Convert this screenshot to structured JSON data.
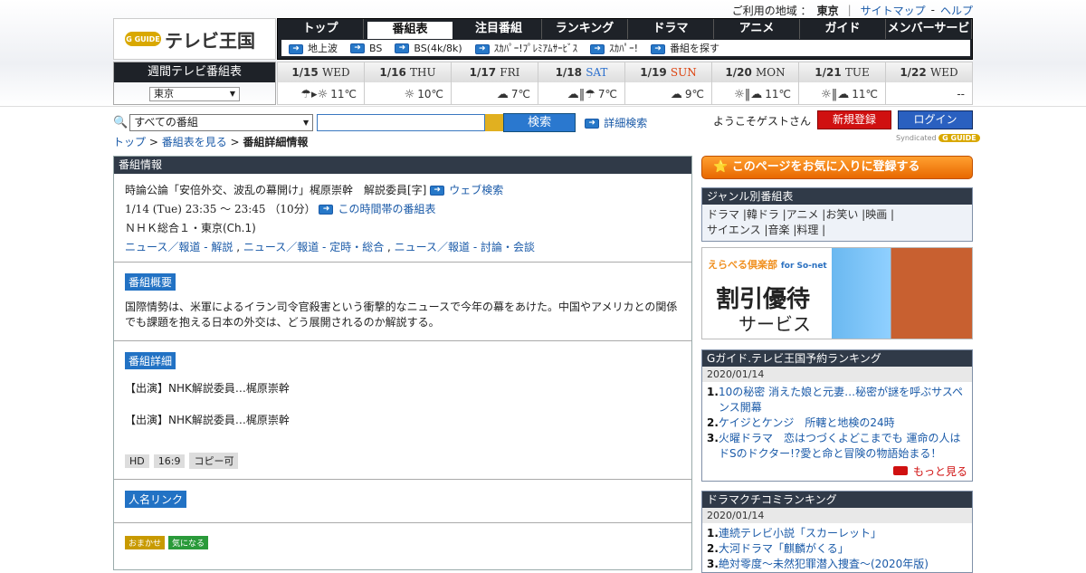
{
  "header": {
    "region_label": "ご利用の地域 ：",
    "region_value": "東京",
    "sitemap": "サイトマップ",
    "help": "ヘルプ",
    "logo_mark": "G GUIDE",
    "logo_text": "テレビ王国",
    "nav": [
      "トップ",
      "番組表",
      "注目番組",
      "ランキング",
      "ドラマ",
      "アニメ",
      "ガイド",
      "メンバーサービス"
    ],
    "subnav": [
      "地上波",
      "BS",
      "BS(4k/8k)",
      "ｽｶﾊﾟｰ!ﾌﾟﾚﾐｱﾑｻｰﾋﾞｽ",
      "ｽｶﾊﾟｰ!",
      "番組を探す"
    ]
  },
  "weekly": {
    "title": "週間テレビ番組表",
    "area": "東京"
  },
  "days": [
    {
      "date": "1/15",
      "wk": "WED",
      "type": "normal",
      "weather": "☂▸☼",
      "temp": "11℃"
    },
    {
      "date": "1/16",
      "wk": "THU",
      "type": "normal",
      "weather": "☼",
      "temp": "10℃"
    },
    {
      "date": "1/17",
      "wk": "FRI",
      "type": "normal",
      "weather": "☁",
      "temp": "7℃"
    },
    {
      "date": "1/18",
      "wk": "SAT",
      "type": "sat",
      "weather": "☁‖☂",
      "temp": "7℃"
    },
    {
      "date": "1/19",
      "wk": "SUN",
      "type": "sun",
      "weather": "☁",
      "temp": "9℃"
    },
    {
      "date": "1/20",
      "wk": "MON",
      "type": "normal",
      "weather": "☼‖☁",
      "temp": "11℃"
    },
    {
      "date": "1/21",
      "wk": "TUE",
      "type": "normal",
      "weather": "☼‖☁",
      "temp": "11℃"
    },
    {
      "date": "1/22",
      "wk": "WED",
      "type": "normal",
      "weather": "",
      "temp": "--"
    }
  ],
  "search": {
    "scope": "すべての番組",
    "button": "検索",
    "advanced": "詳細検索"
  },
  "user": {
    "welcome": "ようこそゲストさん",
    "register": "新規登録",
    "login": "ログイン",
    "syndicated": "Syndicated"
  },
  "breadcrumb": [
    "トップ",
    "番組表を見る",
    "番組詳細情報"
  ],
  "program": {
    "section_title": "番組情報",
    "title": "時論公論「安倍外交、波乱の幕開け」梶原崇幹　解説委員[字]",
    "web_search": "ウェブ検索",
    "time": "1/14 (Tue) 23:35 ～ 23:45 （10分）",
    "timeslot_link": "この時間帯の番組表",
    "channel": "ＮＨＫ総合１・東京(Ch.1)",
    "genres": [
      "ニュース／報道 - 解説",
      "ニュース／報道 - 定時・総合",
      "ニュース／報道 - 討論・会談"
    ],
    "summary_label": "番組概要",
    "summary": "国際情勢は、米軍によるイラン司令官殺害という衝撃的なニュースで今年の幕をあけた。中国やアメリカとの関係でも課題を抱える日本の外交は、どう展開されるのか解説する。",
    "detail_label": "番組詳細",
    "detail1": "【出演】NHK解説委員…梶原崇幹",
    "detail2": "【出演】NHK解説委員…梶原崇幹",
    "tags": [
      "HD",
      "16:9",
      "コピー可"
    ],
    "person_label": "人名リンク",
    "btn1": "おまかせ",
    "btn2": "気になる"
  },
  "sidebar": {
    "fav": "このページをお気に入りに登録する",
    "genre_title": "ジャンル別番組表",
    "genre_line1": "ドラマ |韓ドラ |アニメ |お笑い |映画 |",
    "genre_line2": "サイエンス |音楽 |料理 |",
    "ad_brand": "えらべる倶楽部",
    "ad_brand_sub": "for So-net",
    "ad_main": "割引優待",
    "ad_sub": "サービス",
    "rank1_title": "Gガイド.テレビ王国予約ランキング",
    "rank1_date": "2020/01/14",
    "rank1_items": [
      "10の秘密 消えた娘と元妻…秘密が謎を呼ぶサスペンス開幕",
      "ケイジとケンジ　所轄と地検の24時",
      "火曜ドラマ　恋はつづくよどこまでも 運命の人はドSのドクター!?愛と命と冒険の物語始まる！"
    ],
    "rank1_more": "もっと見る",
    "rank2_title": "ドラマクチコミランキング",
    "rank2_date": "2020/01/14",
    "rank2_items": [
      "連続テレビ小説「スカーレット」",
      "大河ドラマ「麒麟がくる」",
      "絶対零度～未然犯罪潜入捜査～(2020年版)"
    ]
  }
}
